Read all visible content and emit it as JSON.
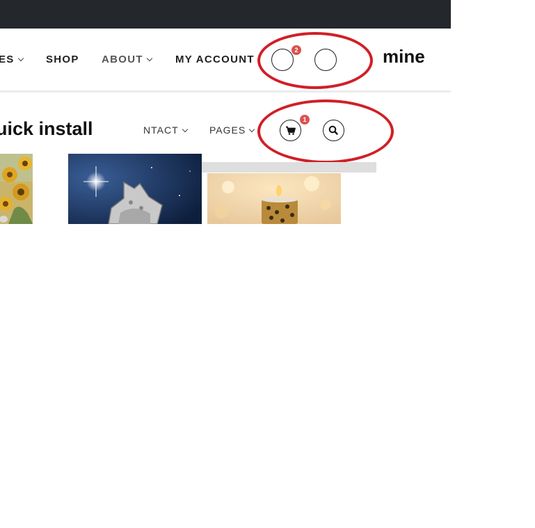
{
  "header": {
    "nav_items": [
      {
        "label": "ES",
        "has_caret": true
      },
      {
        "label": "SHOP",
        "has_caret": false
      },
      {
        "label": "ABOUT",
        "has_caret": true
      },
      {
        "label": "MY ACCOUNT",
        "has_caret": false
      }
    ],
    "cart_badge": "2",
    "annotation": "mine"
  },
  "secondary": {
    "title": "uick install",
    "nav_items": [
      {
        "label": "NTACT",
        "has_caret": true
      },
      {
        "label": "PAGES",
        "has_caret": true
      }
    ],
    "cart_badge": "1",
    "icons": [
      "cart-icon",
      "search-icon"
    ]
  },
  "colors": {
    "topbar": "#24272b",
    "badge": "#d9534f",
    "annotation_ellipse": "#d11f26"
  },
  "products": [
    {
      "image": "sunflowers"
    },
    {
      "image": "star-ornament-night-sky"
    },
    {
      "image": "leopard-candle-bokeh"
    }
  ]
}
